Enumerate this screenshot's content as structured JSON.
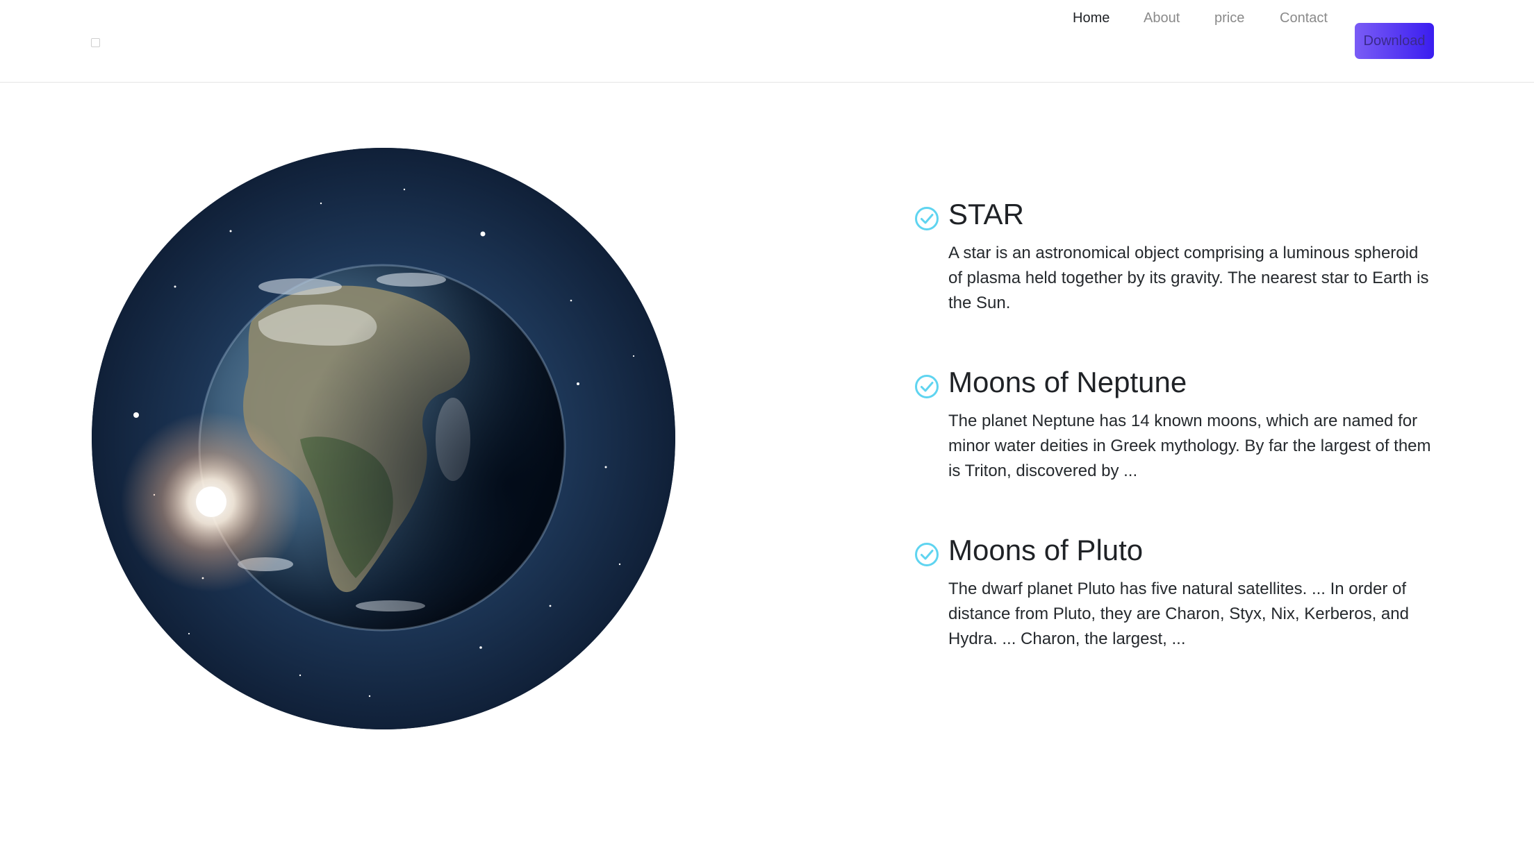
{
  "header": {
    "nav": [
      {
        "label": "Home",
        "active": true
      },
      {
        "label": "About",
        "active": false
      },
      {
        "label": "price",
        "active": false
      },
      {
        "label": "Contact",
        "active": false
      }
    ],
    "download_label": "Download"
  },
  "hero_image": {
    "icon": "earth-in-space-image"
  },
  "features": [
    {
      "title": "STAR",
      "description": "A star is an astronomical object comprising a luminous spheroid of plasma held together by its gravity. The nearest star to Earth is the Sun."
    },
    {
      "title": "Moons of Neptune",
      "description": "The planet Neptune has 14 known moons, which are named for minor water deities in Greek mythology. By far the largest of them is Triton, discovered by ..."
    },
    {
      "title": "Moons of Pluto",
      "description": "The dwarf planet Pluto has five natural satellites. ... In order of distance from Pluto, they are Charon, Styx, Nix, Kerberos, and Hydra. ... Charon, the largest, ..."
    }
  ],
  "colors": {
    "accent_gradient_start": "#7a5cf5",
    "accent_gradient_end": "#3a1df0",
    "check_icon": "#5fd4f0"
  }
}
